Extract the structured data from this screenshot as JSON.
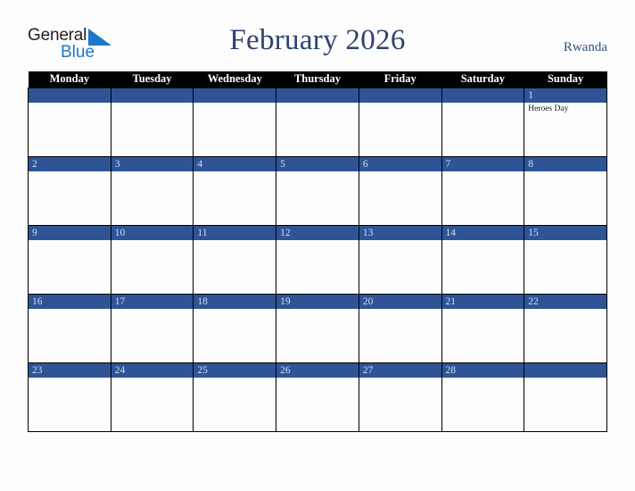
{
  "brand": {
    "name_part1": "General",
    "name_part2": "Blue",
    "triangle_icon": "blue-triangle-icon",
    "dark_color": "#231f20",
    "blue_color": "#1b78c9"
  },
  "header": {
    "title": "February 2026",
    "country": "Rwanda",
    "title_color": "#2c4370",
    "country_color": "#36507e"
  },
  "theme": {
    "header_row_bg": "#000000",
    "header_row_text": "#ffffff",
    "day_band_bg": "#2f5496",
    "day_band_text": "#d6dced",
    "cell_bg": "#fdfdfd",
    "grid_line": "#000000",
    "page_bg": "#fdfdfd"
  },
  "calendar": {
    "month": "February",
    "year": "2026",
    "weekday_headers": [
      "Monday",
      "Tuesday",
      "Wednesday",
      "Thursday",
      "Friday",
      "Saturday",
      "Sunday"
    ],
    "weeks": [
      [
        {
          "day": "",
          "events": []
        },
        {
          "day": "",
          "events": []
        },
        {
          "day": "",
          "events": []
        },
        {
          "day": "",
          "events": []
        },
        {
          "day": "",
          "events": []
        },
        {
          "day": "",
          "events": []
        },
        {
          "day": "1",
          "events": [
            "Heroes Day"
          ]
        }
      ],
      [
        {
          "day": "2",
          "events": []
        },
        {
          "day": "3",
          "events": []
        },
        {
          "day": "4",
          "events": []
        },
        {
          "day": "5",
          "events": []
        },
        {
          "day": "6",
          "events": []
        },
        {
          "day": "7",
          "events": []
        },
        {
          "day": "8",
          "events": []
        }
      ],
      [
        {
          "day": "9",
          "events": []
        },
        {
          "day": "10",
          "events": []
        },
        {
          "day": "11",
          "events": []
        },
        {
          "day": "12",
          "events": []
        },
        {
          "day": "13",
          "events": []
        },
        {
          "day": "14",
          "events": []
        },
        {
          "day": "15",
          "events": []
        }
      ],
      [
        {
          "day": "16",
          "events": []
        },
        {
          "day": "17",
          "events": []
        },
        {
          "day": "18",
          "events": []
        },
        {
          "day": "19",
          "events": []
        },
        {
          "day": "20",
          "events": []
        },
        {
          "day": "21",
          "events": []
        },
        {
          "day": "22",
          "events": []
        }
      ],
      [
        {
          "day": "23",
          "events": []
        },
        {
          "day": "24",
          "events": []
        },
        {
          "day": "25",
          "events": []
        },
        {
          "day": "26",
          "events": []
        },
        {
          "day": "27",
          "events": []
        },
        {
          "day": "28",
          "events": []
        },
        {
          "day": "",
          "events": []
        }
      ]
    ]
  }
}
